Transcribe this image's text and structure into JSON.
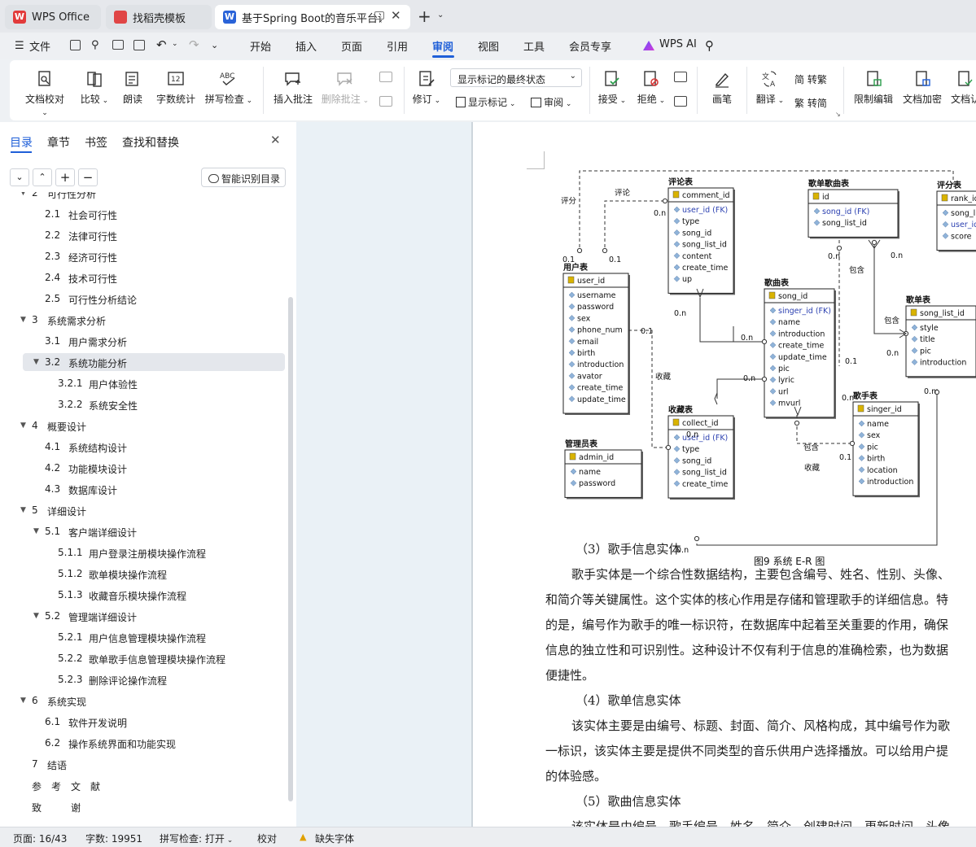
{
  "tabs": [
    {
      "label": "WPS Office"
    },
    {
      "label": "找稻壳模板"
    },
    {
      "label": "基于Spring Boot的音乐平台设"
    }
  ],
  "menu": {
    "file": "文件",
    "items": [
      "开始",
      "插入",
      "页面",
      "引用",
      "审阅",
      "视图",
      "工具",
      "会员专享"
    ],
    "ai": "WPS AI"
  },
  "ribbon": {
    "doc_proofread": "文档校对",
    "compare": "比较",
    "read_aloud": "朗读",
    "word_count": "字数统计",
    "spell_check": "拼写检查",
    "insert_comment": "插入批注",
    "delete_comment": "删除批注",
    "revise": "修订",
    "markup_state": "显示标记的最终状态",
    "show_markup": "显示标记",
    "review": "审阅",
    "accept": "接受",
    "reject": "拒绝",
    "pen": "画笔",
    "translate": "翻译",
    "simp_to_trad": "简 转繁",
    "trad_to_simp": "繁 转简",
    "restrict_edit": "限制编辑",
    "encrypt_doc": "文档加密",
    "doc_auth": "文档认"
  },
  "panel": {
    "tabs": [
      "目录",
      "章节",
      "书签",
      "查找和替换"
    ],
    "smart_toc": "智能识别目录",
    "toc": [
      {
        "num": "2",
        "text": "可行性分析",
        "level": 1,
        "caret": true
      },
      {
        "num": "2.1",
        "text": "社会可行性",
        "level": 2
      },
      {
        "num": "2.2",
        "text": "法律可行性",
        "level": 2
      },
      {
        "num": "2.3",
        "text": "经济可行性",
        "level": 2
      },
      {
        "num": "2.4",
        "text": "技术可行性",
        "level": 2
      },
      {
        "num": "2.5",
        "text": "可行性分析结论",
        "level": 2
      },
      {
        "num": "3",
        "text": "系统需求分析",
        "level": 1,
        "caret": true
      },
      {
        "num": "3.1",
        "text": "用户需求分析",
        "level": 2
      },
      {
        "num": "3.2",
        "text": "系统功能分析",
        "level": 2,
        "caret": true,
        "active": true
      },
      {
        "num": "3.2.1",
        "text": "用户体验性",
        "level": 3
      },
      {
        "num": "3.2.2",
        "text": "系统安全性",
        "level": 3
      },
      {
        "num": "4",
        "text": "概要设计",
        "level": 1,
        "caret": true
      },
      {
        "num": "4.1",
        "text": "系统结构设计",
        "level": 2
      },
      {
        "num": "4.2",
        "text": "功能模块设计",
        "level": 2
      },
      {
        "num": "4.3",
        "text": "数据库设计",
        "level": 2
      },
      {
        "num": "5",
        "text": "详细设计",
        "level": 1,
        "caret": true
      },
      {
        "num": "5.1",
        "text": "客户端详细设计",
        "level": 2,
        "caret": true
      },
      {
        "num": "5.1.1",
        "text": "用户登录注册模块操作流程",
        "level": 3
      },
      {
        "num": "5.1.2",
        "text": "歌单模块操作流程",
        "level": 3
      },
      {
        "num": "5.1.3",
        "text": "收藏音乐模块操作流程",
        "level": 3
      },
      {
        "num": "5.2",
        "text": "管理端详细设计",
        "level": 2,
        "caret": true
      },
      {
        "num": "5.2.1",
        "text": "用户信息管理模块操作流程",
        "level": 3
      },
      {
        "num": "5.2.2",
        "text": "歌单歌手信息管理模块操作流程",
        "level": 3
      },
      {
        "num": "5.2.3",
        "text": "删除评论操作流程",
        "level": 3
      },
      {
        "num": "6",
        "text": "系统实现",
        "level": 1,
        "caret": true
      },
      {
        "num": "6.1",
        "text": "软件开发说明",
        "level": 2
      },
      {
        "num": "6.2",
        "text": "操作系统界面和功能实现",
        "level": 2
      },
      {
        "num": "7",
        "text": "结语",
        "level": 1
      },
      {
        "num": "",
        "text": "参　考　文　献",
        "level": 1
      },
      {
        "num": "",
        "text": "致　　　谢",
        "level": 1
      }
    ]
  },
  "figure": {
    "caption": "图9  系统 E-R 图",
    "tables": {
      "comment": {
        "title": "评论表",
        "pk": "comment_id",
        "fields": [
          "user_id (FK)",
          "type",
          "song_id",
          "song_list_id",
          "content",
          "create_time",
          "up"
        ]
      },
      "songlist_song": {
        "title": "歌单歌曲表",
        "pk": "id",
        "fields": [
          "song_id (FK)",
          "song_list_id"
        ]
      },
      "rank": {
        "title": "评分表",
        "pk": "rank_id",
        "fields": [
          "song_li",
          "user_id",
          "score"
        ]
      },
      "user": {
        "title": "用户表",
        "pk": "user_id",
        "fields": [
          "username",
          "password",
          "sex",
          "phone_num",
          "email",
          "birth",
          "introduction",
          "avator",
          "create_time",
          "update_time"
        ]
      },
      "song": {
        "title": "歌曲表",
        "pk": "song_id",
        "fields": [
          "singer_id (FK)",
          "name",
          "introduction",
          "create_time",
          "update_time",
          "pic",
          "lyric",
          "url",
          "mvurl"
        ]
      },
      "songlist": {
        "title": "歌单表",
        "pk": "song_list_id",
        "fields": [
          "style",
          "title",
          "pic",
          "introduction"
        ]
      },
      "collect": {
        "title": "收藏表",
        "pk": "collect_id",
        "fields": [
          "user_id (FK)",
          "type",
          "song_id",
          "song_list_id",
          "create_time"
        ]
      },
      "singer": {
        "title": "歌手表",
        "pk": "singer_id",
        "fields": [
          "name",
          "sex",
          "pic",
          "birth",
          "location",
          "introduction"
        ]
      },
      "admin": {
        "title": "管理员表",
        "pk": "admin_id",
        "fields": [
          "name",
          "password"
        ]
      }
    },
    "labels": {
      "rate": "评分",
      "comment": "评论",
      "collect": "收藏",
      "contain": "包含",
      "card_0n": "0.n",
      "card_01": "0.1",
      "card_1": "0.1"
    }
  },
  "body": {
    "h3": "（3）歌手信息实体",
    "p3": [
      "歌手实体是一个综合性数据结构，主要包含编号、姓名、性别、头像、",
      "和简介等关键属性。这个实体的核心作用是存储和管理歌手的详细信息。特",
      "的是，编号作为歌手的唯一标识符，在数据库中起着至关重要的作用，确保",
      "信息的独立性和可识别性。这种设计不仅有利于信息的准确检索，也为数据",
      "便捷性。"
    ],
    "h4": "（4）歌单信息实体",
    "p4": [
      "该实体主要是由编号、标题、封面、简介、风格构成，其中编号作为歌",
      "一标识，该实体主要是提供不同类型的音乐供用户选择播放。可以给用户提",
      "的体验感。"
    ],
    "h5": "（5）歌曲信息实体",
    "p5": "该实体是由编号、歌手编号、姓名、简介、创建时间、更新时间、头像"
  },
  "status": {
    "page": "页面: 16/43",
    "words": "字数: 19951",
    "spell": "拼写检查: 打开",
    "proof": "校对",
    "missing_font": "缺失字体"
  },
  "colors": {
    "accent": "#1f5fd8",
    "wps_red": "#e23b3b",
    "active_row": "#e4e7ec"
  }
}
